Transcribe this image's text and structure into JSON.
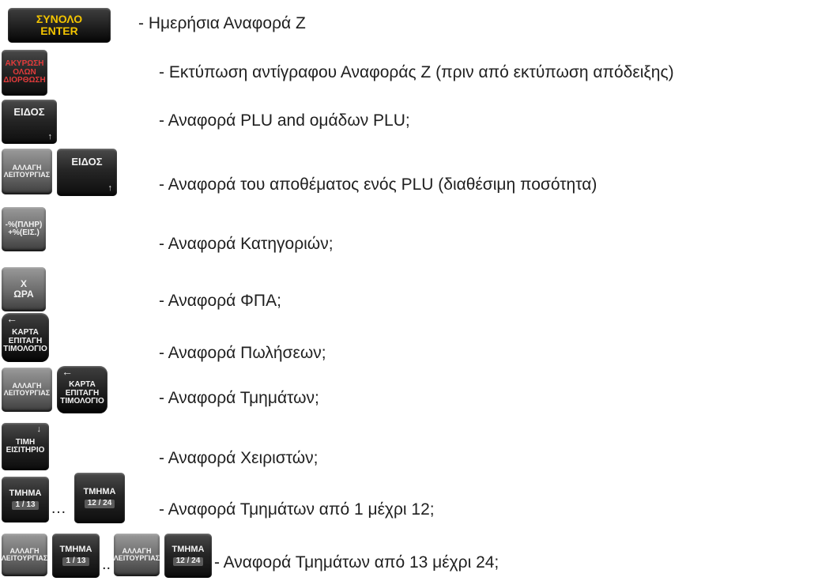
{
  "rows": [
    {
      "keys": [
        {
          "lines": [
            "ΣΥΝΟΛΟ",
            "ENTER"
          ]
        }
      ],
      "text": "- Ημερήσια Αναφορά Ζ"
    },
    {
      "keys": [
        {
          "lines": [
            "ΑΚΥΡΩΣΗ",
            "ΟΛΩΝ",
            "ΔΙΟΡΘΩΣΗ"
          ]
        }
      ],
      "text": "- Εκτύπωση αντίγραφου Αναφοράς Ζ (πριν από εκτύπωση απόδειξης)"
    },
    {
      "keys": [
        {
          "lines": [
            "ΕΙΔΟΣ"
          ],
          "arrow": "↑"
        }
      ],
      "text": "- Αναφορά  PLU and ομάδων PLU;"
    },
    {
      "keys": [
        {
          "lines": [
            "ΑΛΛΑΓΗ",
            "ΛΕΙΤΟΥΡΓΙΑΣ"
          ]
        },
        {
          "lines": [
            "ΕΙΔΟΣ"
          ],
          "arrow": "↑"
        }
      ],
      "text": "- Αναφορά του αποθέματος ενός PLU (διαθέσιμη ποσότητα)"
    },
    {
      "keys": [
        {
          "lines": [
            "-%(ΠΛΗΡ)",
            "+%(ΕΙΣ.)"
          ]
        }
      ],
      "text": "- Αναφορά Κατηγοριών;"
    },
    {
      "keys": [
        {
          "lines": [
            "X",
            "ΩΡΑ"
          ]
        }
      ],
      "text": "- Αναφορά ΦΠΑ;"
    },
    {
      "keys": [
        {
          "lines": [
            "ΚΑΡΤΑ",
            "ΕΠΙΤΑΓΗ",
            "ΤΙΜΟΛΟΓΙΟ"
          ],
          "arrow": "←"
        }
      ],
      "text": "- Αναφορά Πωλήσεων;"
    },
    {
      "keys": [
        {
          "lines": [
            "ΑΛΛΑΓΗ",
            "ΛΕΙΤΟΥΡΓΙΑΣ"
          ]
        },
        {
          "lines": [
            "ΚΑΡΤΑ",
            "ΕΠΙΤΑΓΗ",
            "ΤΙΜΟΛΟΓΙΟ"
          ],
          "arrow": "←"
        }
      ],
      "text": "- Αναφορά Τμημάτων;"
    },
    {
      "keys": [
        {
          "lines": [
            "ΤΙΜΗ",
            "ΕΙΣΙΤΗΡΙΟ"
          ],
          "arrow": "↓"
        }
      ],
      "text": "- Αναφορά Χειριστών;"
    },
    {
      "keys": [
        {
          "lines": [
            "ΤΜΗΜΑ",
            "1 / 13"
          ]
        },
        {
          "lines": [
            "ΤΜΗΜΑ",
            "12 / 24"
          ]
        }
      ],
      "separator": "…",
      "text": "- Αναφορά Τμημάτων από  1 μέχρι 12;"
    },
    {
      "keys": [
        {
          "lines": [
            "ΑΛΛΑΓΗ",
            "ΛΕΙΤΟΥΡΓΙΑΣ"
          ]
        },
        {
          "lines": [
            "ΤΜΗΜΑ",
            "1 / 13"
          ]
        },
        {
          "lines": [
            "ΑΛΛΑΓΗ",
            "ΛΕΙΤΟΥΡΓΙΑΣ"
          ]
        },
        {
          "lines": [
            "ΤΜΗΜΑ",
            "12 / 24"
          ]
        }
      ],
      "separator": "..",
      "text": "- Αναφορά Τμημάτων από 13 μέχρι 24;"
    }
  ]
}
